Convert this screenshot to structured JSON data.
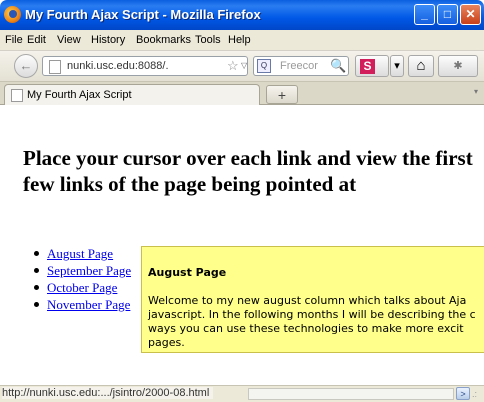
{
  "window": {
    "title": "My Fourth Ajax Script - Mozilla Firefox",
    "min_glyph": "_",
    "max_glyph": "□",
    "close_glyph": "✕"
  },
  "menu": {
    "items": [
      "File",
      "Edit",
      "View",
      "History",
      "Bookmarks",
      "Tools",
      "Help"
    ]
  },
  "nav": {
    "back_glyph": "←",
    "url": "nunki.usc.edu:8088/.",
    "star_glyph": "☆",
    "dropdown_glyph": "▽",
    "reload_glyph": "C",
    "search_placeholder": "Freecor",
    "search_icon_glyph": "🔍",
    "s_glyph": "S",
    "s_dropdown_glyph": "▾",
    "home_glyph": "⌂",
    "ext_glyph": "✱"
  },
  "tabs": {
    "active_label": "My Fourth Ajax Script",
    "new_tab_glyph": "+",
    "tab_list_glyph": "▾"
  },
  "page": {
    "heading": "Place your cursor over each link and view the first few links of the page being pointed at",
    "links": [
      "August Page",
      "September Page",
      "October Page",
      "November Page"
    ]
  },
  "tooltip": {
    "title": "August Page",
    "lines": [
      "Welcome to my new august column which talks about Aja",
      "javascript. In the following months I will be describing the c",
      "ways you can use these technologies to make more excit",
      "pages."
    ]
  },
  "status": {
    "url": "http://nunki.usc.edu:.../jsintro/2000-08.html",
    "scroll_glyph": ">",
    "grip_glyph": ".:"
  },
  "colors": {
    "titlebar": "#0058e6",
    "link": "#0000ee",
    "tooltip_bg": "#ffff8c"
  }
}
